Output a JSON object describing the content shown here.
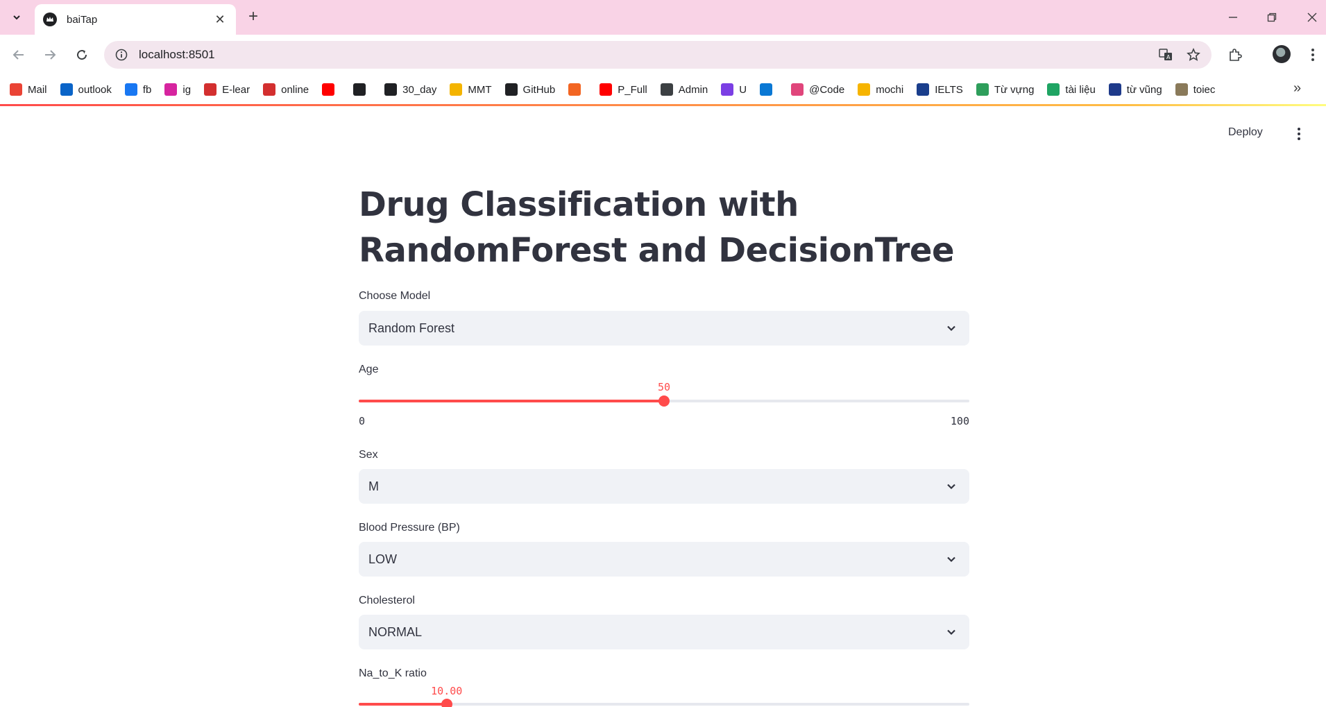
{
  "browser": {
    "tab_title": "baiTap",
    "url": "localhost:8501",
    "bookmarks": [
      {
        "label": "Mail",
        "icon": "gmail-icon",
        "color": "#ea4335"
      },
      {
        "label": "outlook",
        "icon": "outlook-icon",
        "color": "#0a64c8"
      },
      {
        "label": "fb",
        "icon": "facebook-icon",
        "color": "#1877f2"
      },
      {
        "label": "ig",
        "icon": "instagram-icon",
        "color": "#d6249f"
      },
      {
        "label": "E-lear",
        "icon": "shield-icon",
        "color": "#d32f2f"
      },
      {
        "label": "online",
        "icon": "shield-icon",
        "color": "#d32f2f"
      },
      {
        "label": "",
        "icon": "youtube-icon",
        "color": "#ff0000"
      },
      {
        "label": "",
        "icon": "openai-icon",
        "color": "#202124"
      },
      {
        "label": "30_day",
        "icon": "github-icon",
        "color": "#202124"
      },
      {
        "label": "MMT",
        "icon": "classroom-icon",
        "color": "#f4b400"
      },
      {
        "label": "GitHub",
        "icon": "github-icon",
        "color": "#202124"
      },
      {
        "label": "",
        "icon": "box-icon",
        "color": "#f26522"
      },
      {
        "label": "P_Full",
        "icon": "youtube-icon",
        "color": "#ff0000"
      },
      {
        "label": "Admin",
        "icon": "globe-icon",
        "color": "#3c4043"
      },
      {
        "label": "U",
        "icon": "u-icon",
        "color": "#7b3fe4"
      },
      {
        "label": "",
        "icon": "onedrive-icon",
        "color": "#0a78d4"
      },
      {
        "label": "@Code",
        "icon": "code-icon",
        "color": "#e0457b"
      },
      {
        "label": "mochi",
        "icon": "mochi-icon",
        "color": "#f6b400"
      },
      {
        "label": "IELTS",
        "icon": "ielts-icon",
        "color": "#1a3e8c"
      },
      {
        "label": "Từ vựng",
        "icon": "earth-icon",
        "color": "#2e9e5b"
      },
      {
        "label": "tài liệu",
        "icon": "drive-icon",
        "color": "#1fa463"
      },
      {
        "label": "từ vũng",
        "icon": "spiral-icon",
        "color": "#1e3a8a"
      },
      {
        "label": "toiec",
        "icon": "t-icon",
        "color": "#8a7a5a"
      }
    ]
  },
  "app": {
    "deploy_label": "Deploy",
    "title": "Drug Classification with RandomForest and DecisionTree",
    "model": {
      "label": "Choose Model",
      "value": "Random Forest"
    },
    "age": {
      "label": "Age",
      "value": "50",
      "min": "0",
      "max": "100",
      "fraction": 0.5
    },
    "sex": {
      "label": "Sex",
      "value": "M"
    },
    "bp": {
      "label": "Blood Pressure (BP)",
      "value": "LOW"
    },
    "cholesterol": {
      "label": "Cholesterol",
      "value": "NORMAL"
    },
    "na_to_k": {
      "label": "Na_to_K ratio",
      "value": "10.00",
      "fraction": 0.144
    }
  },
  "colors": {
    "accent": "#ff4b4b",
    "select_bg": "#f0f2f6",
    "tabstrip": "#f9d3e6"
  }
}
